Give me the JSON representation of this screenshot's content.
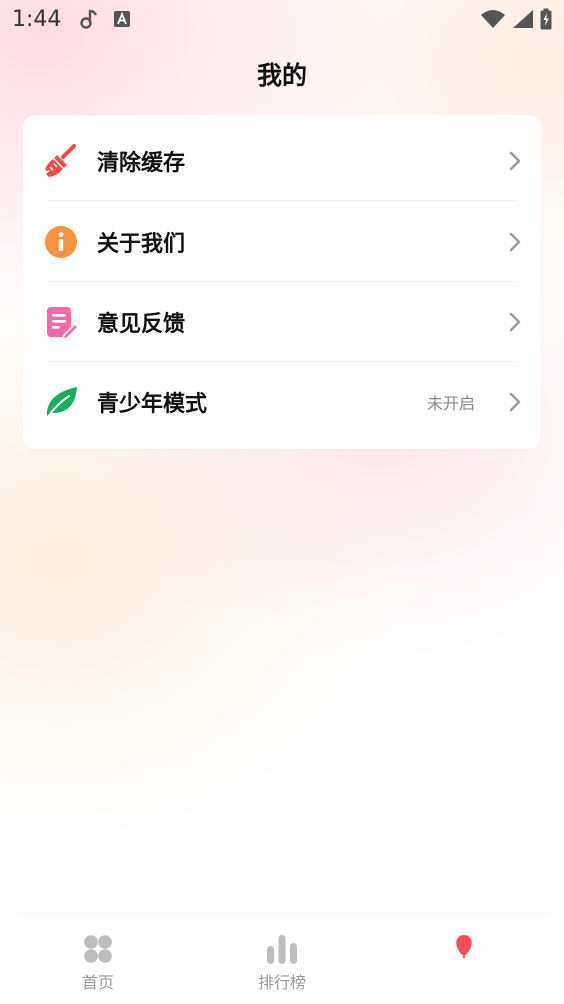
{
  "status_bar": {
    "time": "1:44",
    "icons": [
      "music-note-icon",
      "text-a-icon",
      "wifi-icon",
      "signal-icon",
      "battery-icon"
    ]
  },
  "page": {
    "title": "我的"
  },
  "menu": [
    {
      "label": "清除缓存",
      "icon": "broom-icon",
      "icon_color": "#ef4b4b",
      "status": ""
    },
    {
      "label": "关于我们",
      "icon": "info-icon",
      "icon_color": "#f6913e",
      "status": ""
    },
    {
      "label": "意见反馈",
      "icon": "feedback-note-icon",
      "icon_color": "#f06aa9",
      "status": ""
    },
    {
      "label": "青少年模式",
      "icon": "leaf-icon",
      "icon_color": "#1aad5a",
      "status": "未开启"
    }
  ],
  "bottom_nav": [
    {
      "label": "首页",
      "icon": "grid-four-icon"
    },
    {
      "label": "排行榜",
      "icon": "bar-chart-icon"
    },
    {
      "label": "",
      "icon": "balloon-icon",
      "icon_color": "#f04d58"
    }
  ],
  "colors": {
    "chevron": "#9a9a9a",
    "nav_inactive": "#bdbdbd",
    "divider": "#eeeeee"
  }
}
